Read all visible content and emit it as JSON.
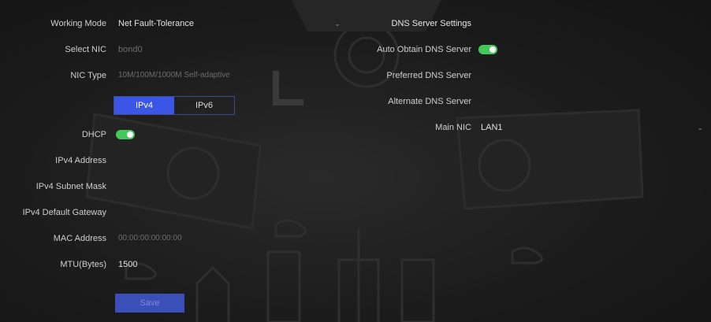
{
  "left": {
    "working_mode": {
      "label": "Working Mode",
      "value": "Net Fault-Tolerance"
    },
    "select_nic": {
      "label": "Select NIC",
      "value": "bond0"
    },
    "nic_type": {
      "label": "NIC Type",
      "value": "10M/100M/1000M Self-adaptive"
    },
    "tabs": [
      {
        "label": "IPv4",
        "active": true
      },
      {
        "label": "IPv6",
        "active": false
      }
    ],
    "dhcp": {
      "label": "DHCP",
      "on": true
    },
    "ipv4_address": {
      "label": "IPv4 Address"
    },
    "ipv4_subnet_mask": {
      "label": "IPv4 Subnet Mask"
    },
    "ipv4_default_gateway": {
      "label": "IPv4 Default Gateway"
    },
    "mac_address": {
      "label": "MAC Address",
      "value": "00:00:00:00:00:00"
    },
    "mtu": {
      "label": "MTU(Bytes)",
      "value": "1500"
    },
    "save_label": "Save"
  },
  "right": {
    "heading": "DNS Server Settings",
    "auto_obtain": {
      "label": "Auto Obtain DNS Server",
      "on": true
    },
    "preferred_dns": {
      "label": "Preferred DNS Server"
    },
    "alternate_dns": {
      "label": "Alternate DNS Server"
    },
    "main_nic": {
      "label": "Main NIC",
      "value": "LAN1"
    }
  },
  "colors": {
    "accent": "#3b55e6",
    "toggle_on": "#43c85a",
    "background": "#1c1c1c"
  },
  "icons": [
    "chevron-down-icon"
  ]
}
